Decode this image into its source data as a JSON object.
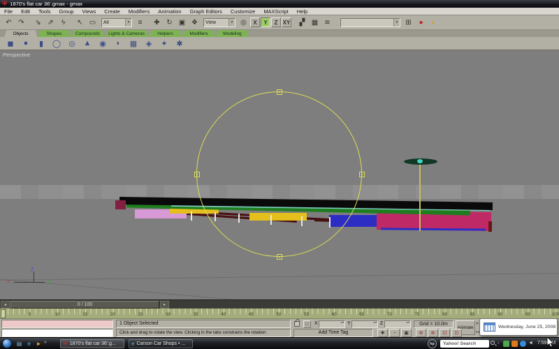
{
  "window": {
    "title": "1870's flat car 36'.gmax - gmax"
  },
  "menubar": {
    "items": [
      "File",
      "Edit",
      "Tools",
      "Group",
      "Views",
      "Create",
      "Modifiers",
      "Animation",
      "Graph Editors",
      "Customize",
      "MAXScript",
      "Help"
    ]
  },
  "toolbar": {
    "selection_filter_value": "All",
    "ref_coord_value": "View",
    "named_selection_value": "",
    "axis_buttons": [
      "X",
      "Y",
      "Z",
      "XY"
    ],
    "active_axis": "Y",
    "items": [
      {
        "t": "icon",
        "n": "undo-icon",
        "g": "↶"
      },
      {
        "t": "icon",
        "n": "redo-icon",
        "g": "↷"
      },
      {
        "t": "sep"
      },
      {
        "t": "icon",
        "n": "select-and-link-icon",
        "g": "⇘"
      },
      {
        "t": "icon",
        "n": "unlink-selection-icon",
        "g": "⇗"
      },
      {
        "t": "icon",
        "n": "bind-to-spacewarp-icon",
        "g": "ϟ"
      },
      {
        "t": "sep"
      },
      {
        "t": "icon",
        "n": "select-object-icon",
        "g": "↖"
      },
      {
        "t": "icon",
        "n": "rectangular-selection-icon",
        "g": "▭"
      },
      {
        "t": "dd",
        "n": "selection-filter-dropdown",
        "v": "All",
        "w": 44
      },
      {
        "t": "icon",
        "n": "select-by-name-icon",
        "g": "≡"
      },
      {
        "t": "sep"
      },
      {
        "t": "icon",
        "n": "select-and-move-icon",
        "g": "✚"
      },
      {
        "t": "icon",
        "n": "select-and-rotate-icon",
        "g": "↻"
      },
      {
        "t": "icon",
        "n": "select-and-scale-icon",
        "g": "▣"
      },
      {
        "t": "icon",
        "n": "select-and-manipulate-icon",
        "g": "❖"
      },
      {
        "t": "dd",
        "n": "reference-coordinate-dropdown",
        "v": "View",
        "w": 46
      },
      {
        "t": "icon",
        "n": "use-pivot-center-icon",
        "g": "◎"
      },
      {
        "t": "axis",
        "v": "X"
      },
      {
        "t": "axis",
        "v": "Y"
      },
      {
        "t": "axis",
        "v": "Z"
      },
      {
        "t": "axis",
        "v": "XY"
      },
      {
        "t": "sep"
      },
      {
        "t": "icon",
        "n": "mirror-icon",
        "g": "▞"
      },
      {
        "t": "icon",
        "n": "array-icon",
        "g": "▦"
      },
      {
        "t": "icon",
        "n": "align-icon",
        "g": "≋"
      },
      {
        "t": "sep"
      },
      {
        "t": "dd",
        "n": "named-selection-dropdown",
        "v": "",
        "w": 86
      },
      {
        "t": "icon",
        "n": "schematic-view-icon",
        "g": "⊞"
      },
      {
        "t": "icon",
        "n": "material-editor-icon",
        "g": "●",
        "c": "#c42222"
      },
      {
        "t": "icon",
        "n": "render-icon",
        "g": "◐",
        "c": "#c8a020"
      }
    ]
  },
  "tabs": {
    "items": [
      "Objects",
      "Shapes",
      "Compounds",
      "Lights & Cameras",
      "Helpers",
      "Modifiers",
      "Modeling"
    ],
    "active": "Objects"
  },
  "object_panel": {
    "icons": [
      {
        "n": "box-icon",
        "g": "◼"
      },
      {
        "n": "sphere-icon",
        "g": "●"
      },
      {
        "n": "cylinder-icon",
        "g": "▮"
      },
      {
        "n": "torus-icon",
        "g": "◯"
      },
      {
        "n": "tube-icon",
        "g": "◎"
      },
      {
        "n": "cone-icon",
        "g": "▲"
      },
      {
        "n": "geosphere-icon",
        "g": "◉"
      },
      {
        "n": "teapot-icon",
        "g": "◗"
      },
      {
        "n": "plane-icon",
        "g": "▦"
      },
      {
        "n": "hedra-icon",
        "g": "◈"
      },
      {
        "n": "star-icon",
        "g": "✦"
      },
      {
        "n": "scatter-icon",
        "g": "✱"
      }
    ]
  },
  "viewport": {
    "label": "Perspective",
    "bg_color": "#7e7e7e",
    "gizmo_color": "#dedd55",
    "axis_labels": {
      "x": "x",
      "y": "Y",
      "z": "z"
    },
    "model": {
      "parts": [
        {
          "name": "truss-rod-1",
          "color": "#471010"
        },
        {
          "name": "truss-rod-2",
          "color": "#471010"
        },
        {
          "name": "truss-rod-3",
          "color": "#471010"
        },
        {
          "name": "truss-rod-4",
          "color": "#471010"
        },
        {
          "name": "rod-frame",
          "color": "#dcdcdc",
          "frame": true
        },
        {
          "name": "board-plum",
          "color": "#d79ad7"
        },
        {
          "name": "board-yellow-left",
          "color": "#e5bf1c"
        },
        {
          "name": "board-yellow-mid",
          "color": "#e5bf1c"
        },
        {
          "name": "block-blue",
          "color": "#2d2dc4"
        },
        {
          "name": "side-magenta",
          "color": "#bf2a66"
        },
        {
          "name": "blue-strip",
          "color": "#2d2dc4"
        },
        {
          "name": "end-post-maroon",
          "color": "#6b1616"
        },
        {
          "name": "side-sill-green",
          "color": "#1f7d1f"
        },
        {
          "name": "deck-edge-teal",
          "color": "#82cfc3"
        },
        {
          "name": "deck",
          "color": "#0a0a0a"
        },
        {
          "name": "end-beam-maroon",
          "color": "#812040"
        },
        {
          "name": "stake-1",
          "color": "#e8e8e8"
        },
        {
          "name": "stake-2",
          "color": "#e8e8e8"
        },
        {
          "name": "stake-3",
          "color": "#e8e8e8"
        },
        {
          "name": "stake-4",
          "color": "#e8e8e8"
        },
        {
          "name": "stake-5",
          "color": "#e8e8e8"
        },
        {
          "name": "stake-6",
          "color": "#e8e8e8"
        },
        {
          "name": "brake-staff",
          "color": "#c6bd5e"
        },
        {
          "name": "brake-wheel",
          "color": "#123826"
        },
        {
          "name": "brake-wheel-hub",
          "color": "#3fd6c0"
        }
      ]
    }
  },
  "timeline": {
    "slider_label": "0 / 100",
    "left_arrow": "◂",
    "right_arrow": "▸",
    "tick_labels": [
      5,
      10,
      15,
      20,
      25,
      30,
      35,
      40,
      45,
      50,
      55,
      60,
      65,
      70,
      75,
      80,
      85,
      90,
      95,
      100
    ],
    "ruler_color": "#a5ac7b"
  },
  "status": {
    "selection_text": "1 Object Selected",
    "prompt_text": "Click and drag to rotate the view.  Clicking in the tabs constrains the rotation",
    "coord_labels": [
      "X",
      "Y",
      "Z"
    ],
    "coord_values": [
      "",
      "",
      ""
    ],
    "grid_text": "Grid = 10.0m",
    "animate_label": "Animate",
    "add_time_tag": "Add Time Tag",
    "go_to_start_glyph": "«",
    "key_mode_glyph": "↦"
  },
  "tooltip": {
    "date_text": "Wednesday, June 25, 2008"
  },
  "taskbar": {
    "quick_launch": [
      {
        "n": "show-desktop-icon",
        "g": "▤",
        "c": "#7ab0d8"
      },
      {
        "n": "internet-explorer-icon",
        "g": "e",
        "c": "#58b0e8"
      },
      {
        "n": "media-player-icon",
        "g": "►",
        "c": "#e8a020"
      }
    ],
    "overflow_chevron": "»",
    "tasks": [
      {
        "label": "1870's flat car 36'.g...",
        "icon": "Ψ",
        "icon_color": "#d42a2a",
        "active": true
      },
      {
        "label": "Carson Car Shops • ...",
        "icon": "e",
        "icon_color": "#58b0e8",
        "active": false
      }
    ],
    "hp_logo_text": "hp",
    "search_text": "Yahoo! Search",
    "tray_chevron": "‹",
    "tray_icons": [
      {
        "n": "tray-icon-green",
        "c": "#4aa84a"
      },
      {
        "n": "tray-icon-orange",
        "c": "#e07820"
      },
      {
        "n": "tray-icon-network",
        "c": "#3a8ad8"
      }
    ],
    "speaker_glyph": "◄",
    "clock": "7:59 PM"
  }
}
